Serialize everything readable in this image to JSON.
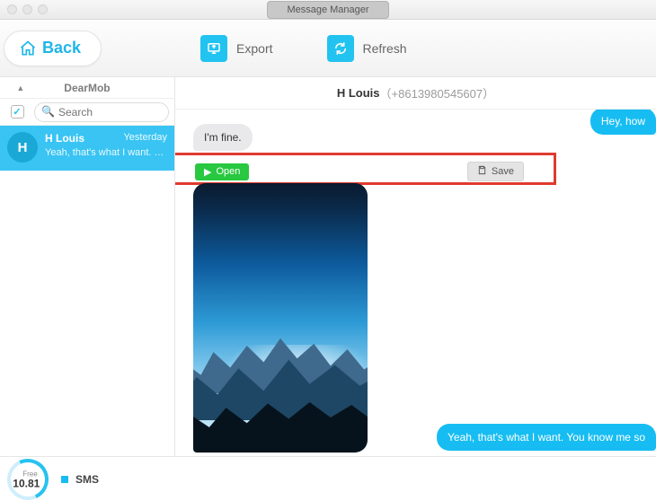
{
  "titlebar": {
    "title": "Message Manager"
  },
  "toolbar": {
    "back_label": "Back",
    "export_label": "Export",
    "refresh_label": "Refresh"
  },
  "sidebar": {
    "brand": "DearMob",
    "search_placeholder": "Search",
    "all_checked": true,
    "conversations": [
      {
        "avatar_initial": "H",
        "name": "H Louis",
        "time": "Yesterday",
        "preview": "Yeah, that's what I want. You kno..."
      }
    ]
  },
  "chat": {
    "header_name": "H Louis",
    "header_phone": "（+8613980545607）",
    "messages": {
      "out_top": "Hey, how",
      "in_1": "I'm fine.",
      "out_bottom": "Yeah, that's what I want. You know me so"
    },
    "attachment": {
      "open_label": "Open",
      "save_label": "Save"
    }
  },
  "storage": {
    "label": "Free",
    "value": "10.81",
    "category": "SMS"
  }
}
